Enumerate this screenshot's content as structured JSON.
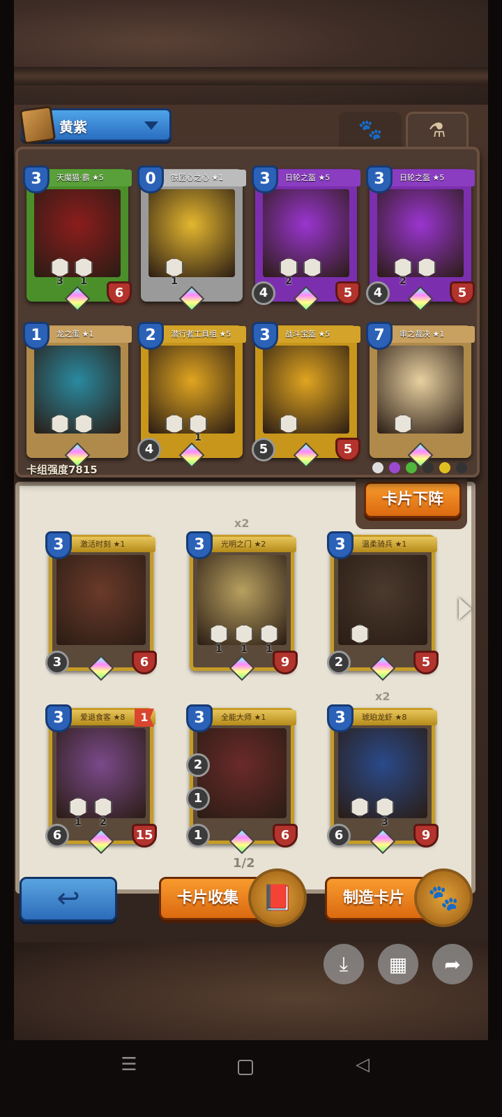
{
  "deck": {
    "name": "黄紫",
    "strength_label": "卡组强度7815",
    "cards": [
      {
        "name": "天魔猫·霸",
        "stars": "★5",
        "cost": "3",
        "attack": "",
        "health": "6",
        "skills": [
          "3",
          "1"
        ],
        "frame": "#4a8f2a",
        "art": "#8b1d1d",
        "ribbon": "#5aa03a"
      },
      {
        "name": "铁匠心之心",
        "stars": "★1",
        "cost": "0",
        "attack": "",
        "health": "",
        "skills": [
          "1"
        ],
        "frame": "#9a9a9a",
        "art": "#e4b72f",
        "ribbon": "#bcbcbc"
      },
      {
        "name": "日轮之盔",
        "stars": "★5",
        "cost": "3",
        "attack": "4",
        "health": "5",
        "skills": [
          "2",
          ""
        ],
        "frame": "#7b2fae",
        "art": "#9a35d0",
        "ribbon": "#8a3dc0"
      },
      {
        "name": "日轮之盔",
        "stars": "★5",
        "cost": "3",
        "attack": "4",
        "health": "5",
        "skills": [
          "2",
          ""
        ],
        "frame": "#7b2fae",
        "art": "#9a35d0",
        "ribbon": "#8a3dc0"
      },
      {
        "name": "龙之蛋",
        "stars": "★1",
        "cost": "1",
        "attack": "",
        "health": "",
        "skills": [
          "",
          ""
        ],
        "frame": "#b08a4a",
        "art": "#2a8aa0",
        "ribbon": "#c8a060"
      },
      {
        "name": "潜行者工具组",
        "stars": "★5",
        "cost": "2",
        "attack": "4",
        "health": "",
        "skills": [
          "",
          "1"
        ],
        "frame": "#c8961a",
        "art": "#e0a520",
        "ribbon": "#d4a42a"
      },
      {
        "name": "战斗宝盔",
        "stars": "★5",
        "cost": "3",
        "attack": "5",
        "health": "5",
        "skills": [
          ""
        ],
        "frame": "#c8961a",
        "art": "#e0a520",
        "ribbon": "#d4a42a"
      },
      {
        "name": "审之裁决",
        "stars": "★1",
        "cost": "7",
        "attack": "",
        "health": "",
        "skills": [
          ""
        ],
        "frame": "#b08a4a",
        "art": "#e8d0a0",
        "ribbon": "#c8a060"
      }
    ]
  },
  "faction_colors": [
    "#dddddd",
    "#9b4ad0",
    "#4fb83a",
    "#333333",
    "#e0c020",
    "#333333"
  ],
  "collection": {
    "page": "1/2",
    "cards": [
      {
        "name": "激活时刻",
        "stars": "★1",
        "cost": "3",
        "attack": "3",
        "health": "6",
        "dup": "",
        "skills": [],
        "art": "#6a3a2a"
      },
      {
        "name": "光明之门",
        "stars": "★2",
        "cost": "3",
        "attack": "",
        "health": "9",
        "dup": "x2",
        "skills": [
          "1",
          "1",
          "1"
        ],
        "art": "#b8a060"
      },
      {
        "name": "温柔骑兵",
        "stars": "★1",
        "cost": "3",
        "attack": "2",
        "health": "5",
        "dup": "",
        "skills": [
          ""
        ],
        "art": "#4a3a2e"
      },
      {
        "name": "爱退食客",
        "stars": "★8",
        "cost": "3",
        "attack": "6",
        "health": "15",
        "dup": "",
        "skills": [
          "1",
          "2"
        ],
        "art": "#7a4a8a",
        "flag": "1"
      },
      {
        "name": "全能大师",
        "stars": "★1",
        "cost": "3",
        "attack": "1",
        "health": "6",
        "dup": "",
        "skills": [],
        "art": "#6a2a2a",
        "side": [
          "2",
          "1"
        ]
      },
      {
        "name": "琥珀龙虾",
        "stars": "★8",
        "cost": "3",
        "attack": "6",
        "health": "9",
        "dup": "x2",
        "skills": [
          "",
          "3"
        ],
        "art": "#2a4a8a"
      }
    ]
  },
  "buttons": {
    "unequip": "卡片下阵",
    "collection": "卡片收集",
    "craft": "制造卡片"
  },
  "icons": {
    "paw_tab": "paw-icon",
    "potion_tab": "potion-icon",
    "back": "back-arrow-icon",
    "download": "download-icon",
    "grid": "grid-icon",
    "share": "share-icon"
  }
}
